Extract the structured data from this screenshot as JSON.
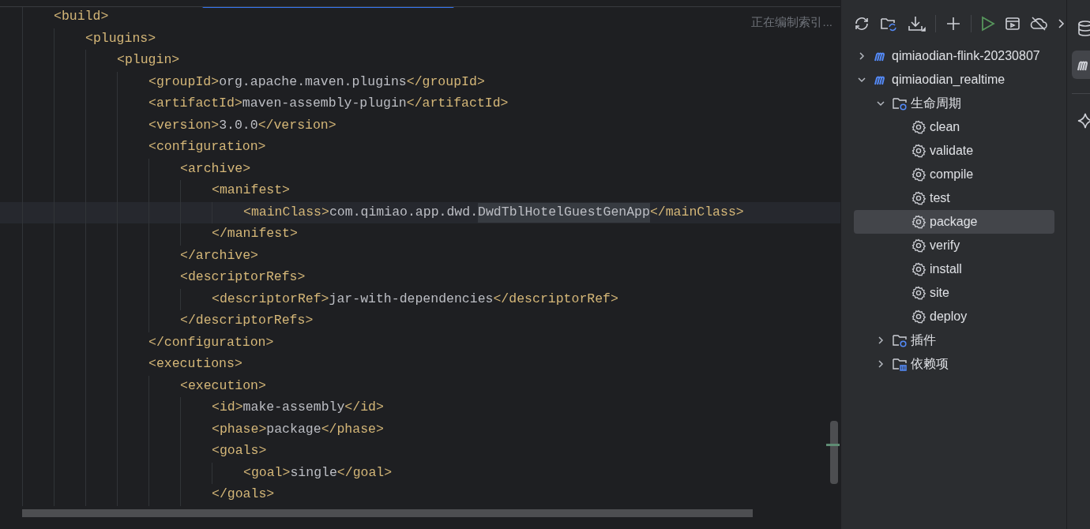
{
  "editor": {
    "status": "正在编制索引...",
    "progress": {
      "level": 0.3
    },
    "lines": [
      {
        "segments": [
          {
            "kind": "tag",
            "text": "<build>"
          }
        ],
        "children": [
          {
            "segments": [
              {
                "kind": "tag",
                "text": "<plugins>"
              }
            ],
            "children": [
              {
                "segments": [
                  {
                    "kind": "tag",
                    "text": "<plugin>"
                  }
                ],
                "children": [
                  {
                    "segments": [
                      {
                        "kind": "tag",
                        "text": "<groupId>"
                      },
                      {
                        "kind": "value",
                        "text": "org.apache.maven.plugins"
                      },
                      {
                        "kind": "tag",
                        "text": "</groupId>"
                      }
                    ]
                  },
                  {
                    "segments": [
                      {
                        "kind": "tag",
                        "text": "<artifactId>"
                      },
                      {
                        "kind": "value",
                        "text": "maven-assembly-plugin"
                      },
                      {
                        "kind": "tag",
                        "text": "</artifactId>"
                      }
                    ]
                  },
                  {
                    "segments": [
                      {
                        "kind": "tag",
                        "text": "<version>"
                      },
                      {
                        "kind": "value",
                        "text": "3.0.0"
                      },
                      {
                        "kind": "tag",
                        "text": "</version>"
                      }
                    ]
                  },
                  {
                    "segments": [
                      {
                        "kind": "tag",
                        "text": "<configuration>"
                      }
                    ],
                    "children": [
                      {
                        "segments": [
                          {
                            "kind": "tag",
                            "text": "<archive>"
                          }
                        ],
                        "children": [
                          {
                            "segments": [
                              {
                                "kind": "tag",
                                "text": "<manifest>"
                              }
                            ],
                            "children": [
                              {
                                "current": true,
                                "segments": [
                                  {
                                    "kind": "tag",
                                    "text": "<mainClass>"
                                  },
                                  {
                                    "kind": "value",
                                    "text": "com.qimiao.app.dwd."
                                  },
                                  {
                                    "kind": "match",
                                    "text": "DwdTblHotelGuestGenApp"
                                  },
                                  {
                                    "kind": "tag",
                                    "text": "</mainClass>"
                                  }
                                ]
                              }
                            ]
                          },
                          {
                            "segments": [
                              {
                                "kind": "tag",
                                "text": "</manifest>"
                              }
                            ]
                          }
                        ]
                      },
                      {
                        "segments": [
                          {
                            "kind": "tag",
                            "text": "</archive>"
                          }
                        ]
                      },
                      {
                        "segments": [
                          {
                            "kind": "tag",
                            "text": "<descriptorRefs>"
                          }
                        ],
                        "children": [
                          {
                            "segments": [
                              {
                                "kind": "tag",
                                "text": "<descriptorRef>"
                              },
                              {
                                "kind": "value",
                                "text": "jar-with-dependencies"
                              },
                              {
                                "kind": "tag",
                                "text": "</descriptorRef>"
                              }
                            ]
                          }
                        ]
                      },
                      {
                        "segments": [
                          {
                            "kind": "tag",
                            "text": "</descriptorRefs>"
                          }
                        ]
                      }
                    ]
                  },
                  {
                    "segments": [
                      {
                        "kind": "tag",
                        "text": "</configuration>"
                      }
                    ]
                  },
                  {
                    "segments": [
                      {
                        "kind": "tag",
                        "text": "<executions>"
                      }
                    ],
                    "children": [
                      {
                        "segments": [
                          {
                            "kind": "tag",
                            "text": "<execution>"
                          }
                        ],
                        "children": [
                          {
                            "segments": [
                              {
                                "kind": "tag",
                                "text": "<id>"
                              },
                              {
                                "kind": "value",
                                "text": "make-assembly"
                              },
                              {
                                "kind": "tag",
                                "text": "</id>"
                              }
                            ]
                          },
                          {
                            "segments": [
                              {
                                "kind": "tag",
                                "text": "<phase>"
                              },
                              {
                                "kind": "value",
                                "text": "package"
                              },
                              {
                                "kind": "tag",
                                "text": "</phase>"
                              }
                            ]
                          },
                          {
                            "segments": [
                              {
                                "kind": "tag",
                                "text": "<goals>"
                              }
                            ],
                            "children": [
                              {
                                "segments": [
                                  {
                                    "kind": "tag",
                                    "text": "<goal>"
                                  },
                                  {
                                    "kind": "value",
                                    "text": "single"
                                  },
                                  {
                                    "kind": "tag",
                                    "text": "</goal>"
                                  }
                                ]
                              }
                            ]
                          },
                          {
                            "segments": [
                              {
                                "kind": "tag",
                                "text": "</goals>"
                              }
                            ]
                          }
                        ]
                      }
                    ]
                  }
                ]
              }
            ]
          }
        ]
      }
    ]
  },
  "maven": {
    "tree": [
      {
        "kind": "module",
        "label": "qimiaodian-flink-20230807",
        "expanded": false,
        "selected": false
      },
      {
        "kind": "module",
        "label": "qimiaodian_realtime",
        "expanded": true,
        "selected": false,
        "children": [
          {
            "kind": "lifecycle",
            "label": "生命周期",
            "expanded": true,
            "selected": false,
            "children": [
              {
                "kind": "goal",
                "label": "clean",
                "selected": false
              },
              {
                "kind": "goal",
                "label": "validate",
                "selected": false
              },
              {
                "kind": "goal",
                "label": "compile",
                "selected": false
              },
              {
                "kind": "goal",
                "label": "test",
                "selected": false
              },
              {
                "kind": "goal",
                "label": "package",
                "selected": true
              },
              {
                "kind": "goal",
                "label": "verify",
                "selected": false
              },
              {
                "kind": "goal",
                "label": "install",
                "selected": false
              },
              {
                "kind": "goal",
                "label": "site",
                "selected": false
              },
              {
                "kind": "goal",
                "label": "deploy",
                "selected": false
              }
            ]
          },
          {
            "kind": "plugins",
            "label": "插件",
            "expanded": false,
            "selected": false
          },
          {
            "kind": "dependencies",
            "label": "依赖项",
            "expanded": false,
            "selected": false
          }
        ]
      }
    ]
  },
  "side_strip": [
    {
      "kind": "database",
      "selected": false
    },
    {
      "kind": "maven",
      "selected": true
    },
    {
      "kind": "ai",
      "selected": false
    }
  ]
}
